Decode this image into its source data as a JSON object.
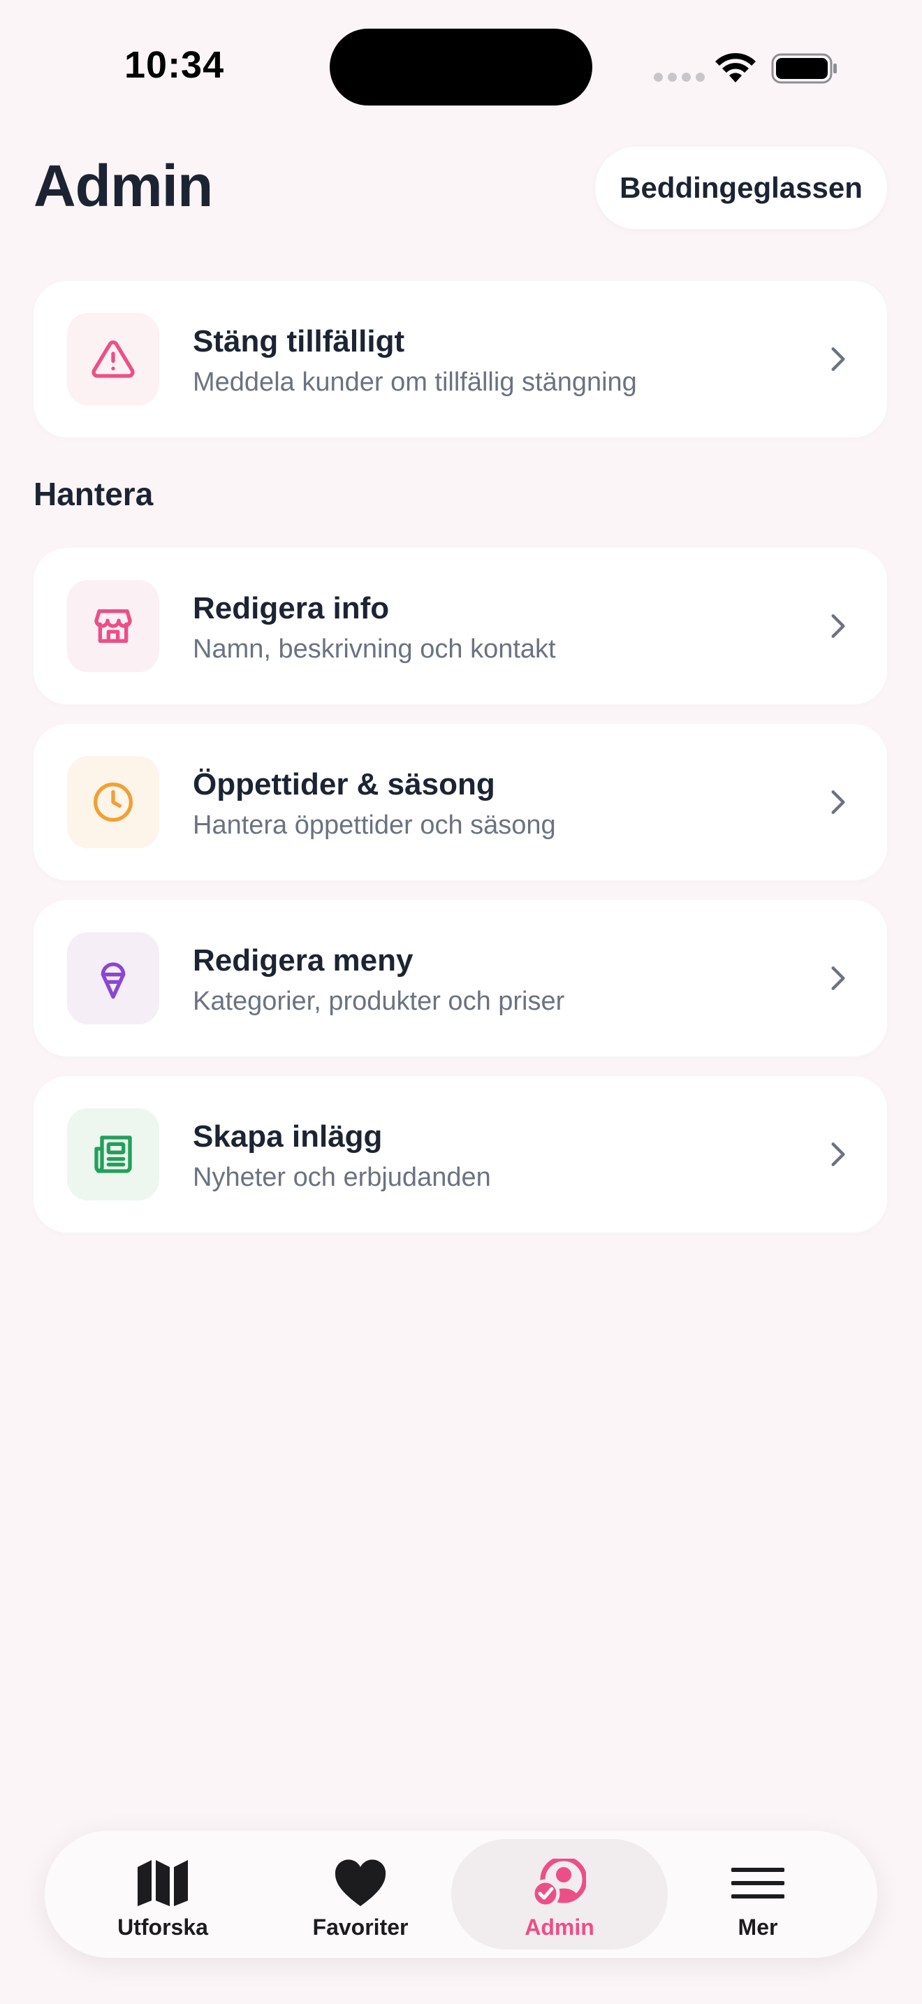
{
  "status_bar": {
    "time": "10:34"
  },
  "header": {
    "title": "Admin",
    "store_name": "Beddingeglassen"
  },
  "close_card": {
    "title": "Stäng tillfälligt",
    "subtitle": "Meddela kunder om tillfällig stängning",
    "icon": "warning-triangle-icon",
    "color": "#ec4f86",
    "bg": "#fcf1f3"
  },
  "manage": {
    "heading": "Hantera",
    "items": [
      {
        "title": "Redigera info",
        "subtitle": "Namn, beskrivning och kontakt",
        "icon": "store-icon",
        "color": "#ec4f86",
        "bg": "#fbf0f3"
      },
      {
        "title": "Öppettider & säsong",
        "subtitle": "Hantera öppettider och säsong",
        "icon": "clock-icon",
        "color": "#f0a033",
        "bg": "#fdf4ea"
      },
      {
        "title": "Redigera meny",
        "subtitle": "Kategorier, produkter och priser",
        "icon": "ice-cream-icon",
        "color": "#8b45d6",
        "bg": "#f5eef6"
      },
      {
        "title": "Skapa inlägg",
        "subtitle": "Nyheter och erbjudanden",
        "icon": "newspaper-icon",
        "color": "#22a05a",
        "bg": "#edf6ef"
      }
    ]
  },
  "tab_bar": {
    "active": "Admin",
    "active_color": "#ec4f86",
    "tabs": [
      {
        "label": "Utforska",
        "icon": "map-icon"
      },
      {
        "label": "Favoriter",
        "icon": "heart-icon"
      },
      {
        "label": "Admin",
        "icon": "admin-user-check-icon"
      },
      {
        "label": "Mer",
        "icon": "menu-icon"
      }
    ]
  }
}
